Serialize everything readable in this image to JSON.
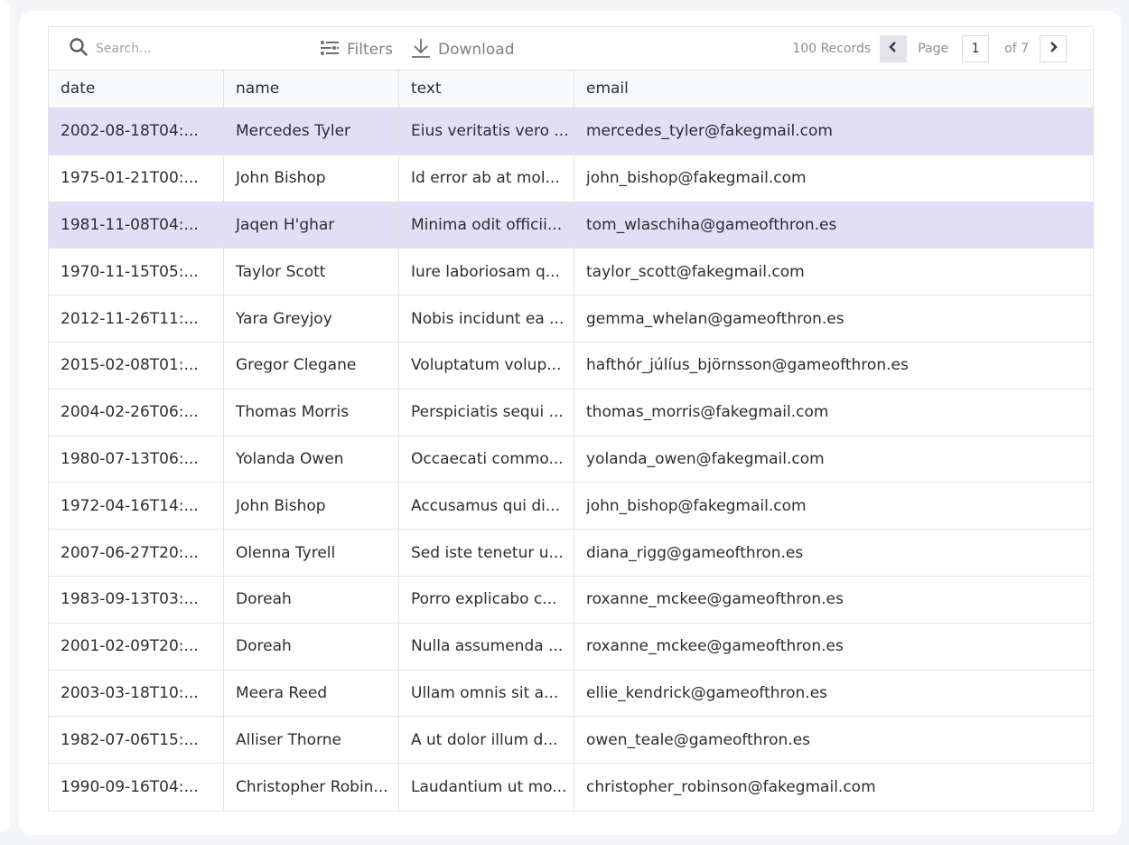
{
  "toolbar": {
    "search_placeholder": "Search...",
    "filters_label": "Filters",
    "download_label": "Download",
    "records_label": "100 Records",
    "page_label": "Page",
    "page_value": "1",
    "of_label": "of 7"
  },
  "columns": [
    "date",
    "name",
    "text",
    "email"
  ],
  "rows": [
    {
      "date": "2002-08-18T04:...",
      "name": "Mercedes Tyler",
      "text": "Eius veritatis vero ...",
      "email": "mercedes_tyler@fakegmail.com",
      "selected": true
    },
    {
      "date": "1975-01-21T00:...",
      "name": "John Bishop",
      "text": "Id error ab at mol...",
      "email": "john_bishop@fakegmail.com",
      "selected": false
    },
    {
      "date": "1981-11-08T04:...",
      "name": "Jaqen H'ghar",
      "text": "Minima odit officii...",
      "email": "tom_wlaschiha@gameofthron.es",
      "selected": true
    },
    {
      "date": "1970-11-15T05:...",
      "name": "Taylor Scott",
      "text": "Iure laboriosam q...",
      "email": "taylor_scott@fakegmail.com",
      "selected": false
    },
    {
      "date": "2012-11-26T11:...",
      "name": "Yara Greyjoy",
      "text": "Nobis incidunt ea ...",
      "email": "gemma_whelan@gameofthron.es",
      "selected": false
    },
    {
      "date": "2015-02-08T01:...",
      "name": "Gregor Clegane",
      "text": "Voluptatum volup...",
      "email": "hafthór_júlíus_björnsson@gameofthron.es",
      "selected": false
    },
    {
      "date": "2004-02-26T06:...",
      "name": "Thomas Morris",
      "text": "Perspiciatis sequi ...",
      "email": "thomas_morris@fakegmail.com",
      "selected": false
    },
    {
      "date": "1980-07-13T06:...",
      "name": "Yolanda Owen",
      "text": "Occaecati commo...",
      "email": "yolanda_owen@fakegmail.com",
      "selected": false
    },
    {
      "date": "1972-04-16T14:...",
      "name": "John Bishop",
      "text": "Accusamus qui di...",
      "email": "john_bishop@fakegmail.com",
      "selected": false
    },
    {
      "date": "2007-06-27T20:...",
      "name": "Olenna Tyrell",
      "text": "Sed iste tenetur u...",
      "email": "diana_rigg@gameofthron.es",
      "selected": false
    },
    {
      "date": "1983-09-13T03:...",
      "name": "Doreah",
      "text": "Porro explicabo c...",
      "email": "roxanne_mckee@gameofthron.es",
      "selected": false
    },
    {
      "date": "2001-02-09T20:...",
      "name": "Doreah",
      "text": "Nulla assumenda ...",
      "email": "roxanne_mckee@gameofthron.es",
      "selected": false
    },
    {
      "date": "2003-03-18T10:...",
      "name": "Meera Reed",
      "text": "Ullam omnis sit a...",
      "email": "ellie_kendrick@gameofthron.es",
      "selected": false
    },
    {
      "date": "1982-07-06T15:...",
      "name": "Alliser Thorne",
      "text": "A ut dolor illum d...",
      "email": "owen_teale@gameofthron.es",
      "selected": false
    },
    {
      "date": "1990-09-16T04:...",
      "name": "Christopher Robin...",
      "text": "Laudantium ut mo...",
      "email": "christopher_robinson@fakegmail.com",
      "selected": false
    }
  ],
  "colors": {
    "selected_row": "#e2def6",
    "border": "#e3e4e8",
    "muted_text": "#7d8089"
  }
}
